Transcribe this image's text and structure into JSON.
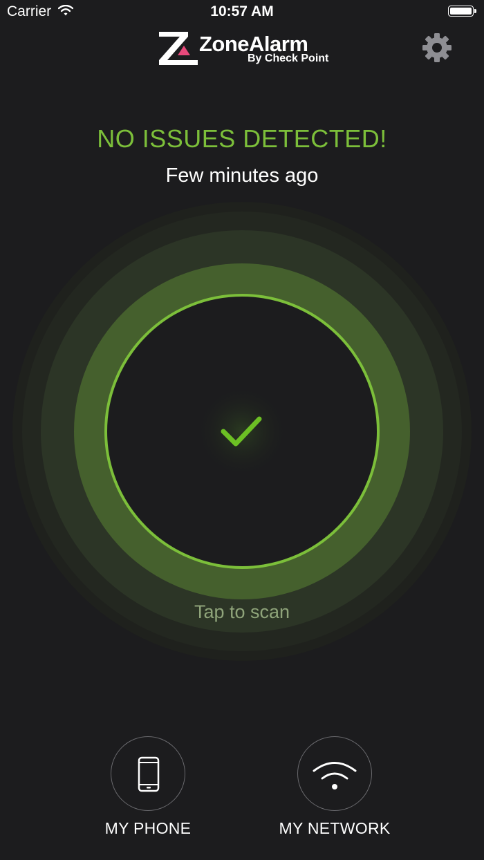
{
  "statusbar": {
    "carrier": "Carrier",
    "time": "10:57 AM"
  },
  "header": {
    "brand": "ZoneAlarm",
    "brand_sub": "By Check Point",
    "settings_icon": "gear-icon"
  },
  "status": {
    "title": "NO ISSUES DETECTED!",
    "last_scan": "Few minutes ago"
  },
  "scan": {
    "tap_label": "Tap to scan",
    "icon": "checkmark-icon"
  },
  "nav": [
    {
      "label": "MY PHONE",
      "icon": "phone-icon"
    },
    {
      "label": "MY NETWORK",
      "icon": "wifi-icon"
    }
  ],
  "colors": {
    "accent": "#7cbf3a",
    "background": "#1c1c1e",
    "ring": "#4a6a2e"
  }
}
